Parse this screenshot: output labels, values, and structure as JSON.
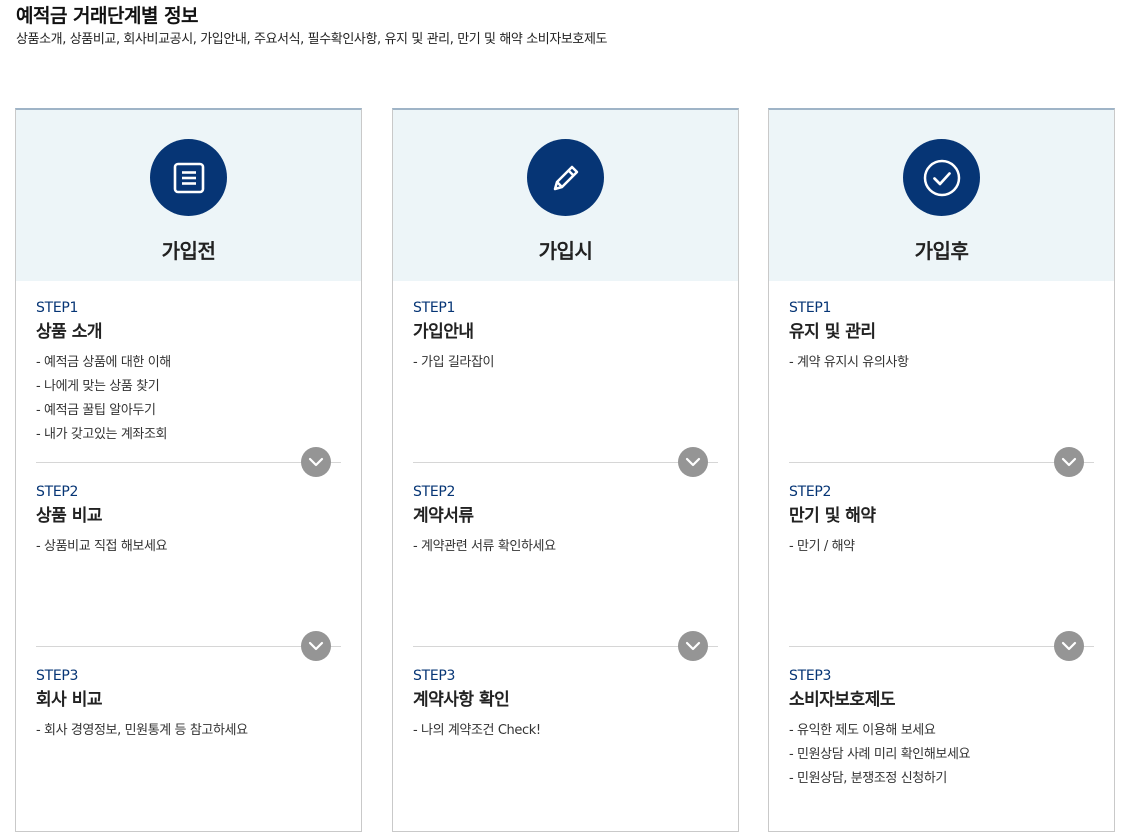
{
  "header": {
    "title": "예적금 거래단계별 정보",
    "subtitle": "상품소개, 상품비교, 회사비교공시, 가입안내, 주요서식, 필수확인사항, 유지 및 관리, 만기 및 해약 소비자보호제도"
  },
  "colors": {
    "accent": "#063575",
    "head_bg": "#edf5f8",
    "toggle": "#959595"
  },
  "stages": [
    {
      "title": "가입전",
      "icon": "document-icon",
      "steps": [
        {
          "label": "STEP1",
          "title": "상품 소개",
          "items": [
            "- 예적금 상품에 대한 이해",
            "- 나에게 맞는 상품 찾기",
            "- 예적금 꿀팁 알아두기",
            "- 내가 갖고있는 계좌조회"
          ]
        },
        {
          "label": "STEP2",
          "title": "상품 비교",
          "items": [
            "- 상품비교 직접 해보세요"
          ]
        },
        {
          "label": "STEP3",
          "title": "회사 비교",
          "items": [
            "- 회사 경영정보, 민원통계 등 참고하세요"
          ]
        }
      ]
    },
    {
      "title": "가입시",
      "icon": "pencil-icon",
      "steps": [
        {
          "label": "STEP1",
          "title": "가입안내",
          "items": [
            "- 가입 길라잡이"
          ]
        },
        {
          "label": "STEP2",
          "title": "계약서류",
          "items": [
            "- 계약관련 서류 확인하세요"
          ]
        },
        {
          "label": "STEP3",
          "title": "계약사항 확인",
          "items": [
            "- 나의 계약조건 Check!"
          ]
        }
      ]
    },
    {
      "title": "가입후",
      "icon": "check-circle-icon",
      "steps": [
        {
          "label": "STEP1",
          "title": "유지 및 관리",
          "items": [
            "- 계약 유지시 유의사항"
          ]
        },
        {
          "label": "STEP2",
          "title": "만기 및 해약",
          "items": [
            "- 만기 / 해약"
          ]
        },
        {
          "label": "STEP3",
          "title": "소비자보호제도",
          "items": [
            "- 유익한 제도 이용해 보세요",
            "- 민원상담 사례 미리 확인해보세요",
            "- 민원상담, 분쟁조정 신청하기"
          ]
        }
      ]
    }
  ]
}
